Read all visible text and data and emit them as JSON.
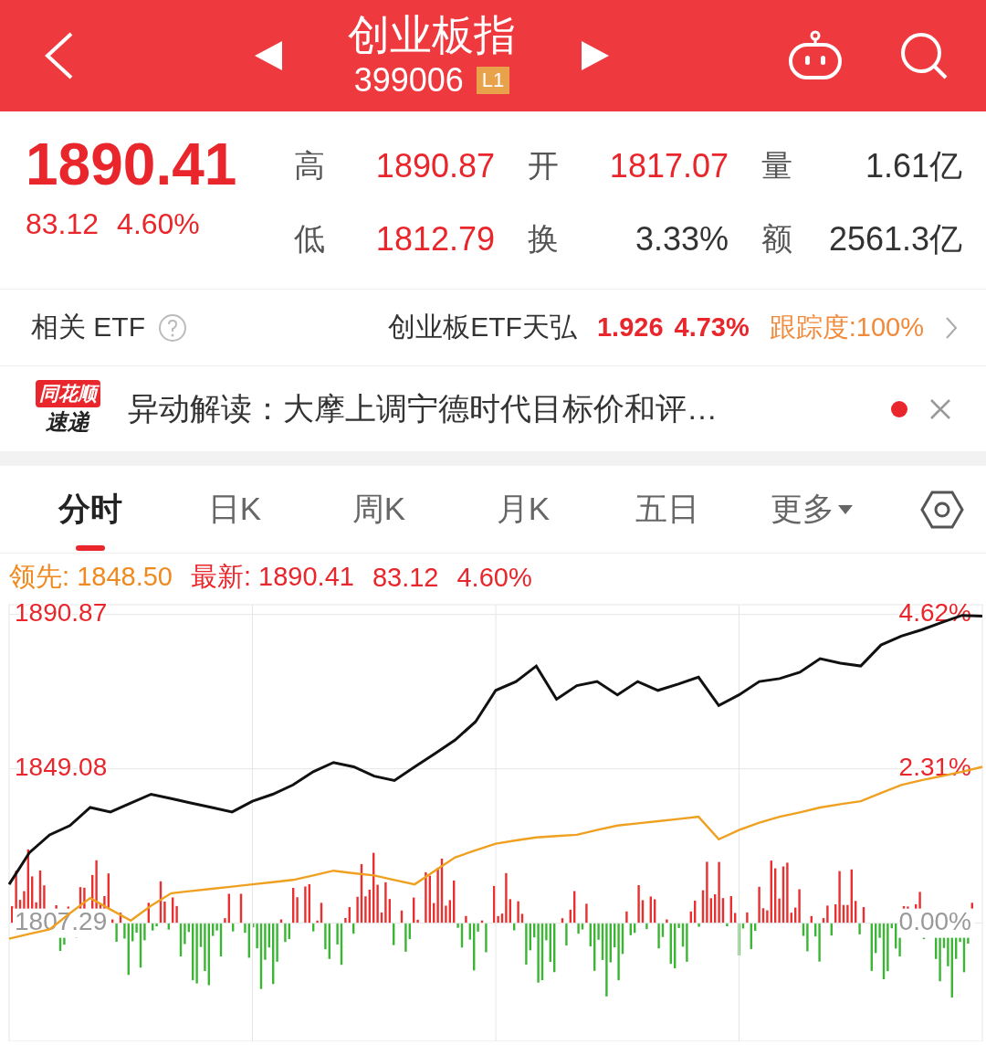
{
  "header": {
    "title": "创业板指",
    "code": "399006",
    "level_badge": "L1"
  },
  "quote": {
    "price": "1890.41",
    "change": "83.12",
    "change_pct": "4.60%",
    "stats": [
      {
        "label": "高",
        "value": "1890.87",
        "color": "#e8262b"
      },
      {
        "label": "开",
        "value": "1817.07",
        "color": "#e8262b"
      },
      {
        "label": "量",
        "value": "1.61亿",
        "color": "#333333"
      },
      {
        "label": "低",
        "value": "1812.79",
        "color": "#e8262b"
      },
      {
        "label": "换",
        "value": "3.33%",
        "color": "#333333"
      },
      {
        "label": "额",
        "value": "2561.3亿",
        "color": "#333333"
      }
    ]
  },
  "etf": {
    "label": "相关 ETF",
    "name": "创业板ETF天弘",
    "price": "1.926",
    "change_pct": "4.73%",
    "tracking": "跟踪度:100%"
  },
  "news": {
    "brand_top": "同花顺",
    "brand_bottom": "速递",
    "text": "异动解读：大摩上调宁德时代目标价和评…",
    "unread": true
  },
  "tabs": [
    {
      "label": "分时",
      "selected": true,
      "kind": "plain"
    },
    {
      "label": "日K",
      "selected": false,
      "kind": "plain"
    },
    {
      "label": "周K",
      "selected": false,
      "kind": "plain"
    },
    {
      "label": "月K",
      "selected": false,
      "kind": "plain"
    },
    {
      "label": "五日",
      "selected": false,
      "kind": "plain"
    },
    {
      "label": "更多",
      "selected": false,
      "kind": "dropdown"
    }
  ],
  "legend": {
    "lead_label": "领先:",
    "lead_value": "1848.50",
    "latest_label": "最新:",
    "latest_value": "1890.41",
    "change": "83.12",
    "change_pct": "4.60%"
  },
  "chart": {
    "percent_labels": [
      "4.62%",
      "2.31%",
      "0.00%"
    ],
    "chart_data": {
      "type": "line",
      "grid": true,
      "categories": [
        null,
        null,
        null,
        null,
        null,
        null,
        null,
        null,
        null,
        null,
        null,
        null,
        null,
        null,
        null,
        null,
        null,
        null,
        null,
        null,
        null,
        null,
        null,
        null,
        null,
        null,
        null,
        null,
        null,
        null,
        null,
        null,
        null,
        null,
        null,
        null,
        null,
        null,
        null,
        null,
        null,
        null,
        null,
        null,
        null,
        null,
        null,
        null,
        null
      ],
      "ylim": [
        1775.3,
        1893.5
      ],
      "yticks": [
        {
          "value": 1890.87,
          "label": "1890.87"
        },
        {
          "value": 1849.08,
          "label": "1849.08"
        },
        {
          "value": 1807.29,
          "label": "1807.29"
        }
      ],
      "series": [
        {
          "color": "#111111",
          "values": [
            1817.8,
            1826.4,
            1831.2,
            1833.7,
            1838.6,
            1837.4,
            1839.8,
            1842.2,
            1841.0,
            1839.8,
            1838.6,
            1837.4,
            1840.3,
            1842.2,
            1844.7,
            1848.3,
            1850.8,
            1849.6,
            1847.1,
            1845.9,
            1849.6,
            1853.2,
            1856.9,
            1861.8,
            1870.3,
            1872.7,
            1876.9,
            1867.9,
            1871.6,
            1872.7,
            1869.1,
            1872.7,
            1870.3,
            1872.0,
            1873.9,
            1866.2,
            1869.1,
            1872.7,
            1873.5,
            1875.2,
            1878.9,
            1877.7,
            1876.9,
            1882.6,
            1885.0,
            1886.7,
            1888.7,
            1890.6,
            1890.4
          ]
        },
        {
          "color": "#f0a020",
          "values": [
            1803.1,
            1804.4,
            1805.6,
            1810.0,
            1814.1,
            1811.0,
            1808.0,
            1812.0,
            1815.4,
            1816.0,
            1816.6,
            1817.2,
            1817.8,
            1818.4,
            1819.0,
            1820.2,
            1821.5,
            1820.8,
            1820.2,
            1819.0,
            1817.8,
            1821.5,
            1825.1,
            1827.0,
            1828.8,
            1829.7,
            1830.5,
            1830.9,
            1831.2,
            1832.5,
            1833.7,
            1834.3,
            1834.9,
            1835.5,
            1836.1,
            1830.0,
            1832.5,
            1834.5,
            1836.1,
            1837.3,
            1838.6,
            1839.5,
            1840.3,
            1842.5,
            1844.7,
            1846.0,
            1847.1,
            1848.3,
            1849.6
          ]
        }
      ]
    }
  }
}
